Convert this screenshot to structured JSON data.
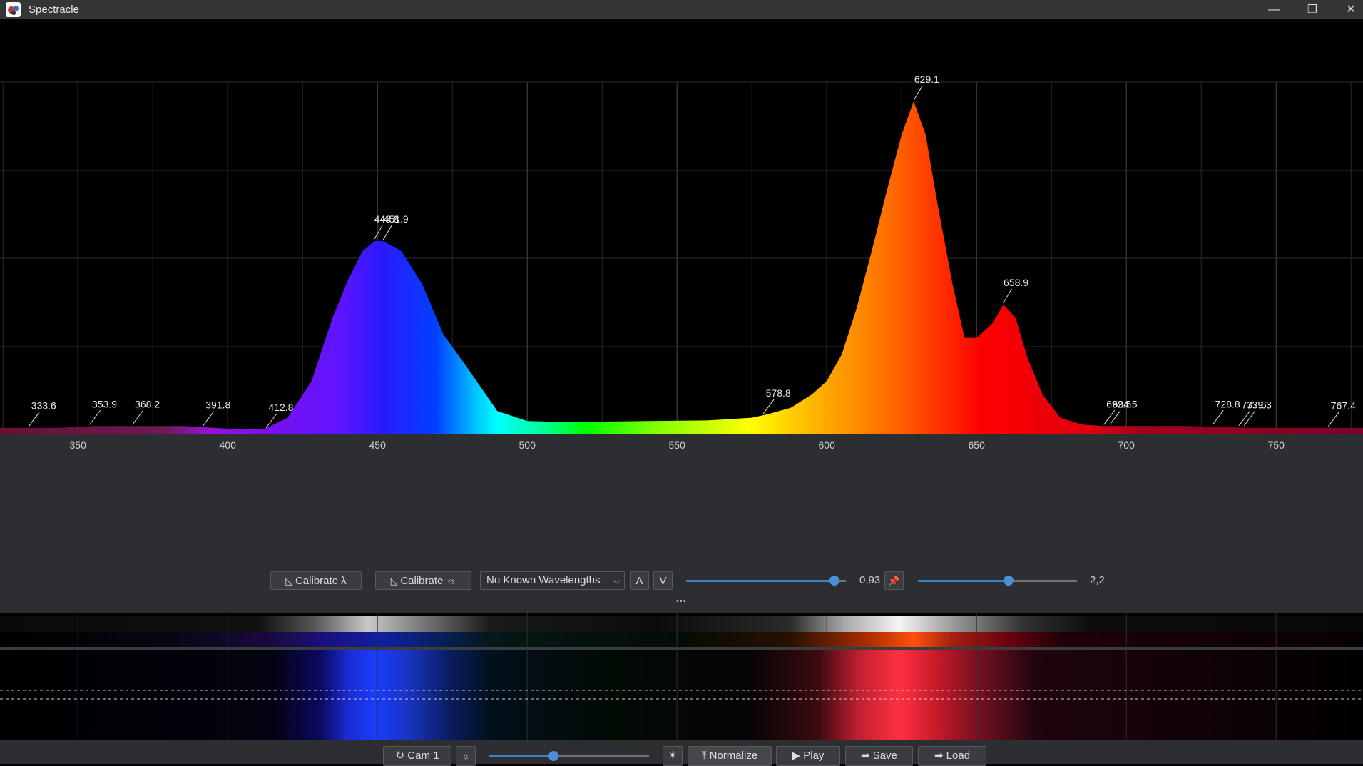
{
  "window": {
    "title": "Spectracle",
    "minimize_glyph": "—",
    "restore_glyph": "❐",
    "close_glyph": "✕"
  },
  "chart_data": {
    "type": "area",
    "xlabel": "",
    "ylabel": "",
    "xlim": [
      324,
      779
    ],
    "ylim": [
      0,
      1
    ],
    "x_ticks": [
      350,
      400,
      450,
      500,
      550,
      600,
      650,
      700,
      750
    ],
    "x_tick_labels": [
      "350",
      "400",
      "450",
      "500",
      "550",
      "600",
      "650",
      "700",
      "750"
    ],
    "grid": true,
    "series": [
      {
        "x": [
          324,
          335,
          345,
          355,
          365,
          375,
          385,
          395,
          405,
          412,
          420,
          428,
          435,
          440,
          445,
          449,
          452,
          458,
          465,
          472,
          480,
          490,
          500,
          510,
          520,
          540,
          560,
          575,
          580,
          588,
          595,
          600,
          605,
          610,
          615,
          620,
          625,
          629,
          633,
          637,
          642,
          646,
          650,
          655,
          659,
          663,
          667,
          672,
          678,
          685,
          692,
          700,
          720,
          740,
          760,
          779
        ],
        "y": [
          0.02,
          0.02,
          0.02,
          0.025,
          0.025,
          0.025,
          0.025,
          0.02,
          0.015,
          0.015,
          0.05,
          0.16,
          0.35,
          0.46,
          0.55,
          0.58,
          0.58,
          0.55,
          0.45,
          0.3,
          0.2,
          0.07,
          0.04,
          0.038,
          0.038,
          0.04,
          0.042,
          0.05,
          0.06,
          0.08,
          0.12,
          0.16,
          0.24,
          0.38,
          0.55,
          0.73,
          0.9,
          1.0,
          0.9,
          0.69,
          0.45,
          0.29,
          0.29,
          0.33,
          0.39,
          0.35,
          0.23,
          0.12,
          0.05,
          0.03,
          0.025,
          0.025,
          0.025,
          0.02,
          0.02,
          0.02
        ]
      }
    ],
    "peak_labels": [
      {
        "x": 333.6,
        "y": 0.02,
        "label": "333.6"
      },
      {
        "x": 353.9,
        "y": 0.025,
        "label": "353.9"
      },
      {
        "x": 368.2,
        "y": 0.025,
        "label": "368.2"
      },
      {
        "x": 391.8,
        "y": 0.022,
        "label": "391.8"
      },
      {
        "x": 412.8,
        "y": 0.015,
        "label": "412.8"
      },
      {
        "x": 448.8,
        "y": 0.58,
        "label": "448.8"
      },
      {
        "x": 451.9,
        "y": 0.58,
        "label": "451.9"
      },
      {
        "x": 578.8,
        "y": 0.058,
        "label": "578.8"
      },
      {
        "x": 629.1,
        "y": 1.0,
        "label": "629.1"
      },
      {
        "x": 658.9,
        "y": 0.39,
        "label": "658.9"
      },
      {
        "x": 692.5,
        "y": 0.025,
        "label": "692.5"
      },
      {
        "x": 694.5,
        "y": 0.025,
        "label": "694.5"
      },
      {
        "x": 728.8,
        "y": 0.025,
        "label": "728.8"
      },
      {
        "x": 737.6,
        "y": 0.022,
        "label": "737.6"
      },
      {
        "x": 739.3,
        "y": 0.022,
        "label": "739.3"
      },
      {
        "x": 767.4,
        "y": 0.02,
        "label": "767.4"
      }
    ]
  },
  "controls": {
    "calibrate_wavelength_label": "Calibrate λ",
    "calibrate_intensity_label": "Calibrate ☼",
    "known_wavelengths_value": "No Known Wavelengths",
    "up_label": "Λ",
    "down_label": "V",
    "slider1_value": "0,93",
    "slider1_fraction": 0.93,
    "slider2_value": "2,2",
    "slider2_fraction": 0.57,
    "more_label": "•••"
  },
  "bottom": {
    "camera_label": "↻ Cam 1",
    "exposure_fraction": 0.4,
    "normalize_label": "⤒ Normalize",
    "play_label": "▶ Play",
    "save_label": "➡ Save",
    "load_label": "➡ Load"
  }
}
